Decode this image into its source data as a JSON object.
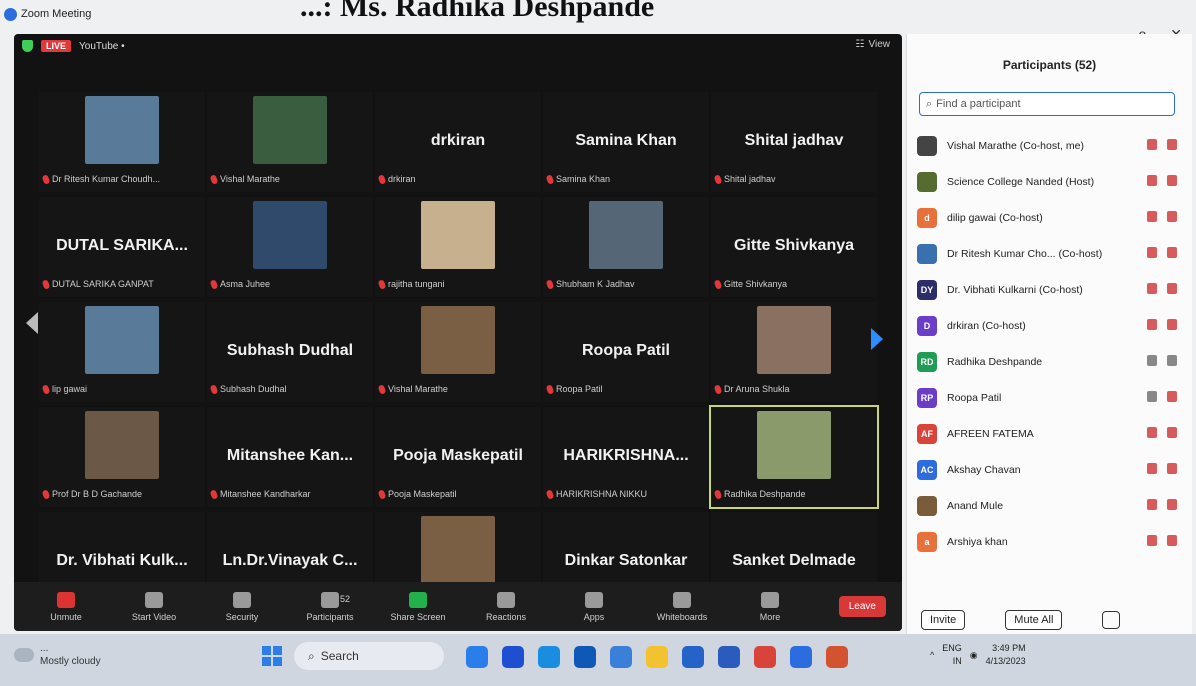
{
  "banner_title": "...: Ms. Radhika Deshpande",
  "window": {
    "title": "Zoom Meeting",
    "controls": [
      "—",
      "o",
      "✕"
    ]
  },
  "meeting": {
    "live_badge": "LIVE",
    "stream": "YouTube •",
    "view_label": "View",
    "tiles": [
      {
        "name_big": "",
        "label": "Dr Ritesh Kumar Choudh...",
        "photo": true
      },
      {
        "name_big": "",
        "label": "Vishal Marathe",
        "photo": true
      },
      {
        "name_big": "drkiran",
        "label": "drkiran",
        "photo": false
      },
      {
        "name_big": "Samina Khan",
        "label": "Samina Khan",
        "photo": false
      },
      {
        "name_big": "Shital jadhav",
        "label": "Shital jadhav",
        "photo": false
      },
      {
        "name_big": "DUTAL SARIKA...",
        "label": "DUTAL SARIKA GANPAT",
        "photo": false
      },
      {
        "name_big": "",
        "label": "Asma Juhee",
        "photo": true
      },
      {
        "name_big": "",
        "label": "rajitha tungani",
        "photo": true
      },
      {
        "name_big": "",
        "label": "Shubham K Jadhav",
        "photo": true
      },
      {
        "name_big": "Gitte Shivkanya",
        "label": "Gitte Shivkanya",
        "photo": false
      },
      {
        "name_big": "",
        "label": "lip gawai",
        "photo": true
      },
      {
        "name_big": "Subhash Dudhal",
        "label": "Subhash Dudhal",
        "photo": false
      },
      {
        "name_big": "",
        "label": "Vishal Marathe",
        "photo": true
      },
      {
        "name_big": "Roopa Patil",
        "label": "Roopa Patil",
        "photo": false
      },
      {
        "name_big": "",
        "label": "Dr Aruna Shukla",
        "photo": true
      },
      {
        "name_big": "",
        "label": "Prof Dr B D Gachande",
        "photo": true
      },
      {
        "name_big": "Mitanshee Kan...",
        "label": "Mitanshee Kandharkar",
        "photo": false
      },
      {
        "name_big": "Pooja Maskepatil",
        "label": "Pooja Maskepatil",
        "photo": false
      },
      {
        "name_big": "HARIKRISHNA...",
        "label": "HARIKRISHNA NIKKU",
        "photo": false
      },
      {
        "name_big": "",
        "label": "Radhika Deshpande",
        "photo": true
      },
      {
        "name_big": "Dr. Vibhati Kulk...",
        "label": "Dr. Vibhati Kulkarni",
        "photo": false
      },
      {
        "name_big": "Ln.Dr.Vinayak C...",
        "label": "Ln Dr Vinayak Chavan",
        "photo": false
      },
      {
        "name_big": "",
        "label": "Science College Nanded",
        "photo": true
      },
      {
        "name_big": "Dinkar Satonkar",
        "label": "Dinkar Satonkar",
        "photo": false
      },
      {
        "name_big": "Sanket Delmade",
        "label": "Sanket Delmade",
        "photo": false
      }
    ],
    "toolbar": [
      {
        "label": "Unmute",
        "icon": "mic-muted-icon"
      },
      {
        "label": "Start Video",
        "icon": "video-off-icon"
      },
      {
        "label": "Security",
        "icon": "shield-icon"
      },
      {
        "label": "Participants",
        "icon": "participants-icon",
        "count": "52"
      },
      {
        "label": "Share Screen",
        "icon": "share-screen-icon"
      },
      {
        "label": "Reactions",
        "icon": "reactions-icon"
      },
      {
        "label": "Apps",
        "icon": "apps-icon"
      },
      {
        "label": "Whiteboards",
        "icon": "whiteboard-icon"
      },
      {
        "label": "More",
        "icon": "more-icon"
      }
    ],
    "leave_label": "Leave"
  },
  "participants_panel": {
    "title": "Participants (52)",
    "search_placeholder": "Find a participant",
    "list": [
      {
        "initials": "",
        "name": "Vishal Marathe (Co-host, me)",
        "color": "#444444"
      },
      {
        "initials": "",
        "name": "Science College Nanded (Host)",
        "color": "#556b2f"
      },
      {
        "initials": "d",
        "name": "dilip gawai (Co-host)",
        "color": "#e8703a"
      },
      {
        "initials": "",
        "name": "Dr Ritesh Kumar Cho... (Co-host)",
        "color": "#3a6fb0"
      },
      {
        "initials": "DY",
        "name": "Dr. Vibhati Kulkarni (Co-host)",
        "color": "#2d2d6a"
      },
      {
        "initials": "D",
        "name": "drkiran (Co-host)",
        "color": "#6a3ec9"
      },
      {
        "initials": "RD",
        "name": "Radhika Deshpande",
        "color": "#1f9d55"
      },
      {
        "initials": "RP",
        "name": "Roopa Patil",
        "color": "#6a3ec9"
      },
      {
        "initials": "AF",
        "name": "AFREEN FATEMA",
        "color": "#d9443a"
      },
      {
        "initials": "AC",
        "name": "Akshay Chavan",
        "color": "#2d6cdf"
      },
      {
        "initials": "",
        "name": "Anand Mule",
        "color": "#7a5c3a"
      },
      {
        "initials": "a",
        "name": "Arshiya khan",
        "color": "#e8703a"
      }
    ],
    "invite_label": "Invite",
    "mute_all_label": "Mute All"
  },
  "taskbar": {
    "weather": "Mostly cloudy",
    "weather_top": "...",
    "search_label": "Search",
    "lang": "ENG",
    "region": "IN",
    "time": "3:49 PM",
    "date": "4/13/2023"
  },
  "photo_colors": [
    "#5a7a9a",
    "#3b5d3f",
    "#7a5f45",
    "#4e6a55",
    "#8a7060",
    "#6b5847",
    "#2f4a6a",
    "#c7b08e",
    "#556677",
    "#8b9a6a"
  ]
}
